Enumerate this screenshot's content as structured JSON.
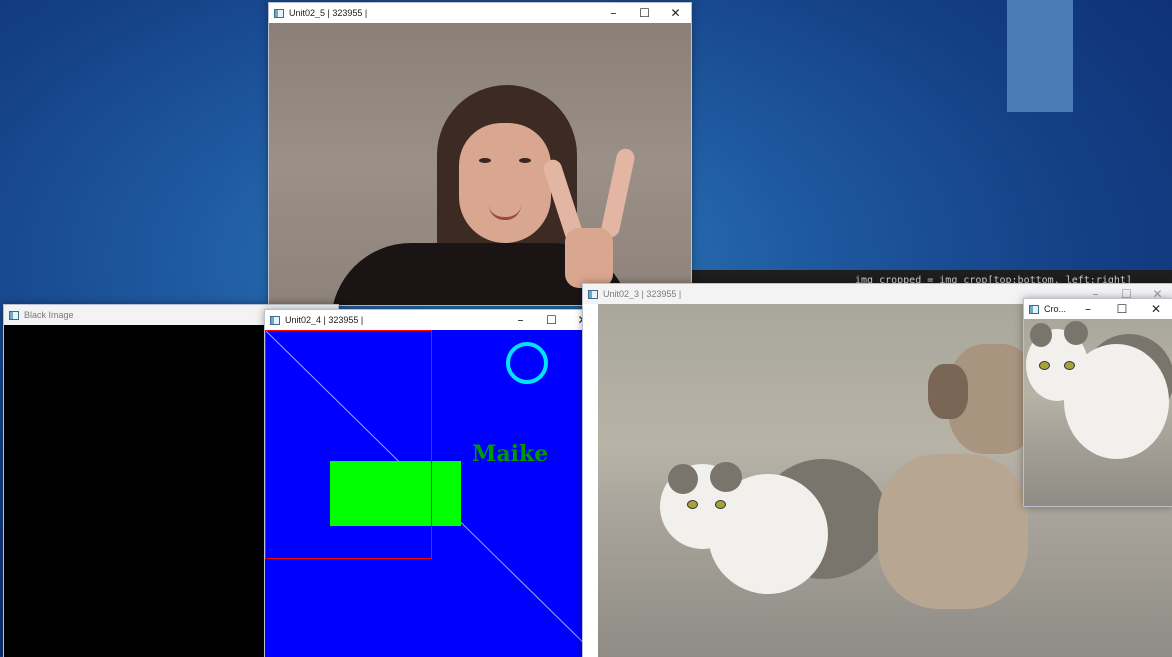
{
  "colors": {
    "drawing_blue": "#0000ff",
    "drawing_green": "#00ff00",
    "circle_cyan": "#00e5ff",
    "text_green": "#009900",
    "rect_red": "#ff0000"
  },
  "icons": {
    "app": "opencv-window-icon",
    "minimize": "minimize-icon",
    "maximize": "maximize-icon",
    "close": "close-icon"
  },
  "controls": {
    "minimize": "–",
    "maximize": "☐",
    "close": "✕"
  },
  "windows": {
    "webcam": {
      "title": "Unit02_5 | 323955 |"
    },
    "black": {
      "title": "Black Image"
    },
    "drawing": {
      "title": "Unit02_4 | 323955 |",
      "label": "Maike"
    },
    "cats": {
      "title": "Unit02_3 | 323955 |"
    },
    "crop": {
      "title": "Cro..."
    }
  },
  "background_code_text": "img_cropped = img_crop[top:bottom, left:right]"
}
